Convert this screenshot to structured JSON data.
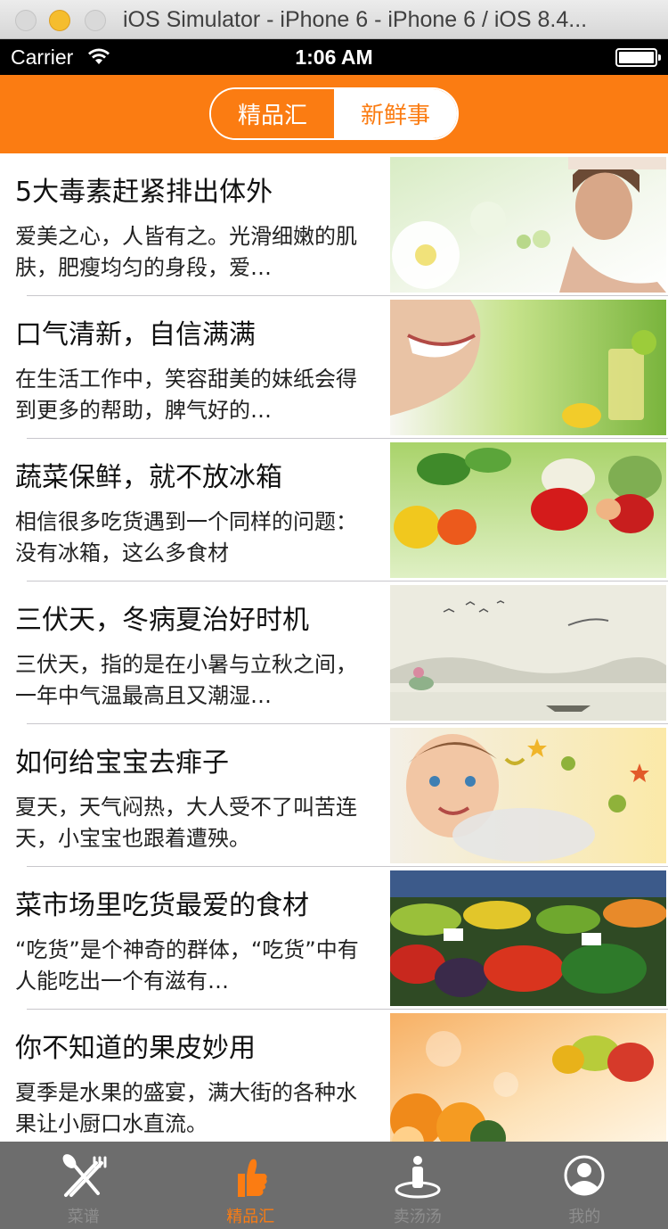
{
  "window": {
    "title": "iOS Simulator - iPhone 6 - iPhone 6 / iOS 8.4..."
  },
  "status_bar": {
    "carrier": "Carrier",
    "time": "1:06 AM"
  },
  "nav": {
    "segments": [
      "精品汇",
      "新鲜事"
    ],
    "selected_index": 0,
    "accent_color": "#fb7c12"
  },
  "articles": [
    {
      "title": "5大毒素赶紧排出体外",
      "summary": "爱美之心，人皆有之。光滑细嫩的肌肤，肥瘦均匀的身段，爱…",
      "image": "spa-woman-flowers"
    },
    {
      "title": "口气清新，自信满满",
      "summary": "在生活工作中，笑容甜美的妹纸会得到更多的帮助，脾气好的…",
      "image": "smiling-woman-lemon-drink"
    },
    {
      "title": "蔬菜保鲜，就不放冰箱",
      "summary": "相信很多吃货遇到一个同样的问题：没有冰箱，这么多食材",
      "image": "vegetables-peppers"
    },
    {
      "title": "三伏天，冬病夏治好时机",
      "summary": "三伏天，指的是在小暑与立秋之间，一年中气温最高且又潮湿…",
      "image": "ink-landscape-boat"
    },
    {
      "title": "如何给宝宝去痱子",
      "summary": "夏天，天气闷热，大人受不了叫苦连天，小宝宝也跟着遭殃。",
      "image": "baby-bath-stars"
    },
    {
      "title": "菜市场里吃货最爱的食材",
      "summary": "“吃货”是个神奇的群体，“吃货”中有人能吃出一个有滋有…",
      "image": "market-produce"
    },
    {
      "title": "你不知道的果皮妙用",
      "summary": "夏季是水果的盛宴，满大街的各种水果让小厨口水直流。",
      "image": "oranges-fruit"
    }
  ],
  "tab_bar": {
    "tabs": [
      {
        "label": "菜谱",
        "icon": "fork-knife-icon"
      },
      {
        "label": "精品汇",
        "icon": "thumbs-up-icon"
      },
      {
        "label": "卖汤汤",
        "icon": "person-pin-icon"
      },
      {
        "label": "我的",
        "icon": "user-circle-icon"
      }
    ],
    "selected_index": 1
  }
}
